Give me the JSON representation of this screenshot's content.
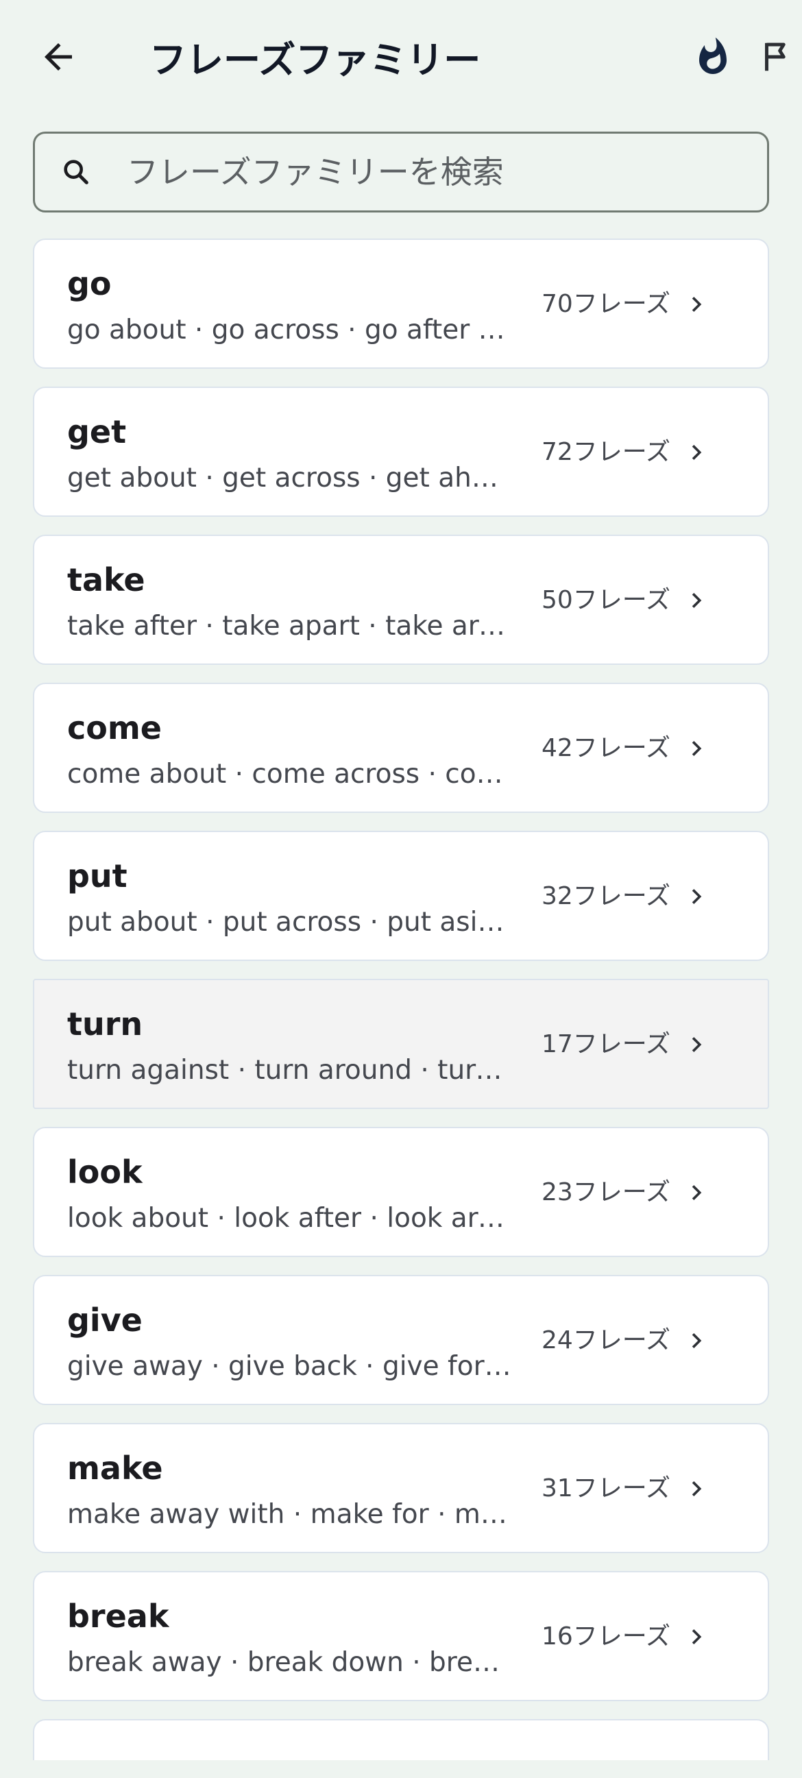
{
  "header": {
    "title": "フレーズファミリー",
    "back_icon": "arrow-left-icon",
    "streak_icon": "fire-icon",
    "flag_icon": "flag-icon"
  },
  "search": {
    "placeholder": "フレーズファミリーを検索",
    "value": "",
    "icon": "search-icon"
  },
  "families": [
    {
      "verb": "go",
      "examples": "go about · go across · go after …",
      "count": "70フレーズ"
    },
    {
      "verb": "get",
      "examples": "get about · get across · get ahea…",
      "count": "72フレーズ"
    },
    {
      "verb": "take",
      "examples": "take after · take apart · take aro…",
      "count": "50フレーズ"
    },
    {
      "verb": "come",
      "examples": "come about · come across · co…",
      "count": "42フレーズ"
    },
    {
      "verb": "put",
      "examples": "put about · put across · put asid…",
      "count": "32フレーズ"
    },
    {
      "verb": "turn",
      "examples": "turn against · turn around · turn …",
      "count": "17フレーズ"
    },
    {
      "verb": "look",
      "examples": "look about · look after · look aro…",
      "count": "23フレーズ"
    },
    {
      "verb": "give",
      "examples": "give away · give back · give forth…",
      "count": "24フレーズ"
    },
    {
      "verb": "make",
      "examples": "make away with · make for · ma…",
      "count": "31フレーズ"
    },
    {
      "verb": "break",
      "examples": "break away · break down · break…",
      "count": "16フレーズ"
    }
  ],
  "colors": {
    "background": "#eef4f0",
    "card": "#ffffff",
    "card_pressed": "#f3f3f3",
    "title": "#121826",
    "secondary_text": "#44474e"
  }
}
